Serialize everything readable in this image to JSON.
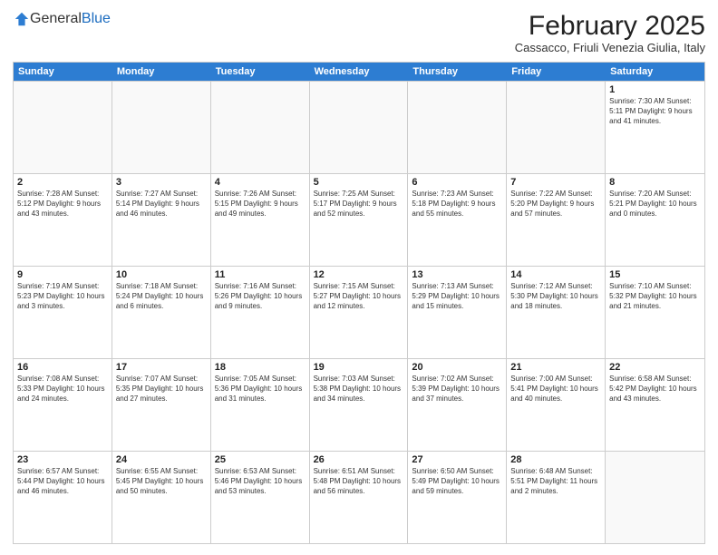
{
  "logo": {
    "general": "General",
    "blue": "Blue"
  },
  "header": {
    "title": "February 2025",
    "subtitle": "Cassacco, Friuli Venezia Giulia, Italy"
  },
  "weekdays": [
    "Sunday",
    "Monday",
    "Tuesday",
    "Wednesday",
    "Thursday",
    "Friday",
    "Saturday"
  ],
  "weeks": [
    [
      {
        "day": "",
        "info": ""
      },
      {
        "day": "",
        "info": ""
      },
      {
        "day": "",
        "info": ""
      },
      {
        "day": "",
        "info": ""
      },
      {
        "day": "",
        "info": ""
      },
      {
        "day": "",
        "info": ""
      },
      {
        "day": "1",
        "info": "Sunrise: 7:30 AM\nSunset: 5:11 PM\nDaylight: 9 hours and 41 minutes."
      }
    ],
    [
      {
        "day": "2",
        "info": "Sunrise: 7:28 AM\nSunset: 5:12 PM\nDaylight: 9 hours and 43 minutes."
      },
      {
        "day": "3",
        "info": "Sunrise: 7:27 AM\nSunset: 5:14 PM\nDaylight: 9 hours and 46 minutes."
      },
      {
        "day": "4",
        "info": "Sunrise: 7:26 AM\nSunset: 5:15 PM\nDaylight: 9 hours and 49 minutes."
      },
      {
        "day": "5",
        "info": "Sunrise: 7:25 AM\nSunset: 5:17 PM\nDaylight: 9 hours and 52 minutes."
      },
      {
        "day": "6",
        "info": "Sunrise: 7:23 AM\nSunset: 5:18 PM\nDaylight: 9 hours and 55 minutes."
      },
      {
        "day": "7",
        "info": "Sunrise: 7:22 AM\nSunset: 5:20 PM\nDaylight: 9 hours and 57 minutes."
      },
      {
        "day": "8",
        "info": "Sunrise: 7:20 AM\nSunset: 5:21 PM\nDaylight: 10 hours and 0 minutes."
      }
    ],
    [
      {
        "day": "9",
        "info": "Sunrise: 7:19 AM\nSunset: 5:23 PM\nDaylight: 10 hours and 3 minutes."
      },
      {
        "day": "10",
        "info": "Sunrise: 7:18 AM\nSunset: 5:24 PM\nDaylight: 10 hours and 6 minutes."
      },
      {
        "day": "11",
        "info": "Sunrise: 7:16 AM\nSunset: 5:26 PM\nDaylight: 10 hours and 9 minutes."
      },
      {
        "day": "12",
        "info": "Sunrise: 7:15 AM\nSunset: 5:27 PM\nDaylight: 10 hours and 12 minutes."
      },
      {
        "day": "13",
        "info": "Sunrise: 7:13 AM\nSunset: 5:29 PM\nDaylight: 10 hours and 15 minutes."
      },
      {
        "day": "14",
        "info": "Sunrise: 7:12 AM\nSunset: 5:30 PM\nDaylight: 10 hours and 18 minutes."
      },
      {
        "day": "15",
        "info": "Sunrise: 7:10 AM\nSunset: 5:32 PM\nDaylight: 10 hours and 21 minutes."
      }
    ],
    [
      {
        "day": "16",
        "info": "Sunrise: 7:08 AM\nSunset: 5:33 PM\nDaylight: 10 hours and 24 minutes."
      },
      {
        "day": "17",
        "info": "Sunrise: 7:07 AM\nSunset: 5:35 PM\nDaylight: 10 hours and 27 minutes."
      },
      {
        "day": "18",
        "info": "Sunrise: 7:05 AM\nSunset: 5:36 PM\nDaylight: 10 hours and 31 minutes."
      },
      {
        "day": "19",
        "info": "Sunrise: 7:03 AM\nSunset: 5:38 PM\nDaylight: 10 hours and 34 minutes."
      },
      {
        "day": "20",
        "info": "Sunrise: 7:02 AM\nSunset: 5:39 PM\nDaylight: 10 hours and 37 minutes."
      },
      {
        "day": "21",
        "info": "Sunrise: 7:00 AM\nSunset: 5:41 PM\nDaylight: 10 hours and 40 minutes."
      },
      {
        "day": "22",
        "info": "Sunrise: 6:58 AM\nSunset: 5:42 PM\nDaylight: 10 hours and 43 minutes."
      }
    ],
    [
      {
        "day": "23",
        "info": "Sunrise: 6:57 AM\nSunset: 5:44 PM\nDaylight: 10 hours and 46 minutes."
      },
      {
        "day": "24",
        "info": "Sunrise: 6:55 AM\nSunset: 5:45 PM\nDaylight: 10 hours and 50 minutes."
      },
      {
        "day": "25",
        "info": "Sunrise: 6:53 AM\nSunset: 5:46 PM\nDaylight: 10 hours and 53 minutes."
      },
      {
        "day": "26",
        "info": "Sunrise: 6:51 AM\nSunset: 5:48 PM\nDaylight: 10 hours and 56 minutes."
      },
      {
        "day": "27",
        "info": "Sunrise: 6:50 AM\nSunset: 5:49 PM\nDaylight: 10 hours and 59 minutes."
      },
      {
        "day": "28",
        "info": "Sunrise: 6:48 AM\nSunset: 5:51 PM\nDaylight: 11 hours and 2 minutes."
      },
      {
        "day": "",
        "info": ""
      }
    ]
  ]
}
